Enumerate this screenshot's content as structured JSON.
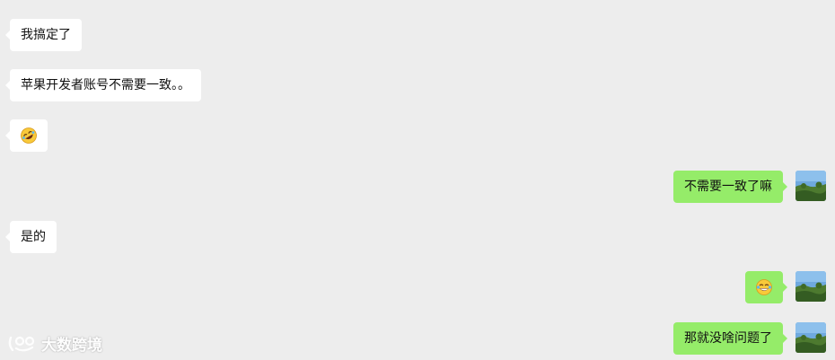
{
  "messages": [
    {
      "side": "left",
      "type": "text",
      "text": "我搞定了"
    },
    {
      "side": "left",
      "type": "text",
      "text": "苹果开发者账号不需要一致。。"
    },
    {
      "side": "left",
      "type": "emoji",
      "icon": "rolling-laugh-emoji-icon"
    },
    {
      "side": "right",
      "type": "text",
      "text": "不需要一致了嘛"
    },
    {
      "side": "left",
      "type": "text",
      "text": "是的"
    },
    {
      "side": "right",
      "type": "emoji",
      "icon": "tears-of-joy-emoji-icon"
    },
    {
      "side": "right",
      "type": "text",
      "text": "那就没啥问题了"
    }
  ],
  "watermark": {
    "text": "大数跨境"
  },
  "colors": {
    "background": "#ededed",
    "incoming_bubble": "#ffffff",
    "outgoing_bubble": "#95ec69"
  }
}
